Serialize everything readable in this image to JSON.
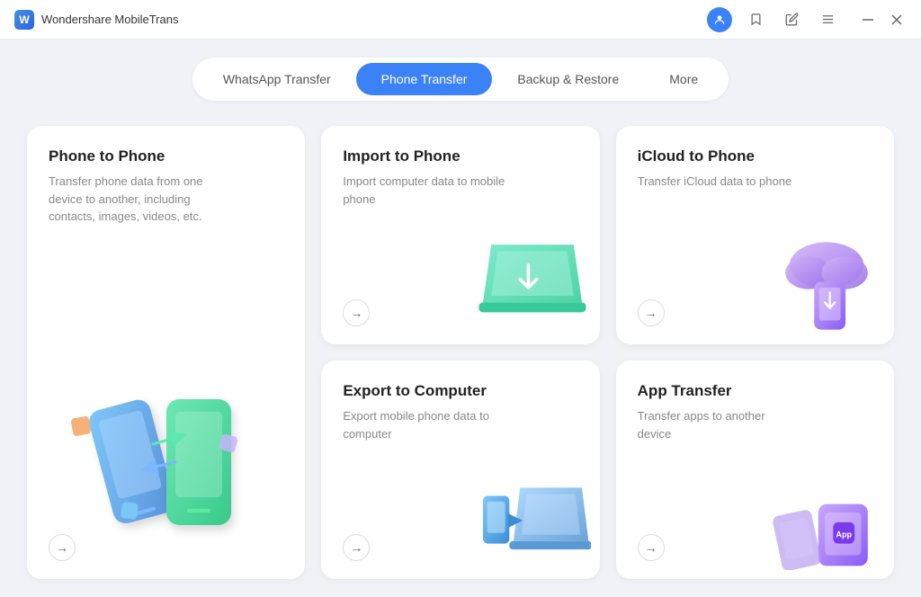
{
  "titlebar": {
    "app_name": "Wondershare MobileTrans",
    "icons": [
      "user",
      "bookmark",
      "edit",
      "menu",
      "minimize",
      "close"
    ]
  },
  "nav": {
    "tabs": [
      {
        "label": "WhatsApp Transfer",
        "active": false
      },
      {
        "label": "Phone Transfer",
        "active": true
      },
      {
        "label": "Backup & Restore",
        "active": false
      },
      {
        "label": "More",
        "active": false
      }
    ]
  },
  "cards": [
    {
      "id": "phone-to-phone",
      "title": "Phone to Phone",
      "description": "Transfer phone data from one device to another, including contacts, images, videos, etc.",
      "large": true
    },
    {
      "id": "import-to-phone",
      "title": "Import to Phone",
      "description": "Import computer data to mobile phone",
      "large": false
    },
    {
      "id": "icloud-to-phone",
      "title": "iCloud to Phone",
      "description": "Transfer iCloud data to phone",
      "large": false
    },
    {
      "id": "export-to-computer",
      "title": "Export to Computer",
      "description": "Export mobile phone data to computer",
      "large": false
    },
    {
      "id": "app-transfer",
      "title": "App Transfer",
      "description": "Transfer apps to another device",
      "large": false
    }
  ],
  "colors": {
    "accent": "#3b82f6",
    "background": "#f0f2f7",
    "card": "#ffffff"
  }
}
